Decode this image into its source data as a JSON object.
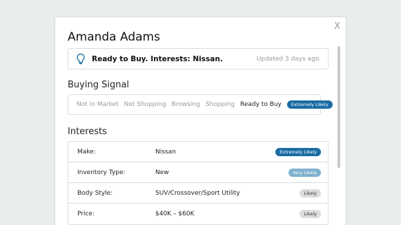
{
  "modal": {
    "close_label": "X",
    "name": "Amanda Adams",
    "summary": {
      "icon": "lightbulb-icon",
      "text": "Ready to Buy. Interests: Nissan.",
      "updated": "Updated 3 days ago."
    },
    "buying_signal": {
      "title": "Buying Signal",
      "steps": [
        "Not in Market",
        "Not Shopping",
        "Browsing",
        "Shopping",
        "Ready to Buy"
      ],
      "active_step": "Ready to Buy",
      "badge": "Extremely Likely"
    },
    "interests": {
      "title": "Interests",
      "rows": [
        {
          "label": "Make:",
          "value": "Nissan",
          "badge": "Extremely Likely"
        },
        {
          "label": "Inventory Type:",
          "value": "New",
          "badge": "Very Likely"
        },
        {
          "label": "Body Style:",
          "value": "SUV/Crossover/Sport Utility",
          "badge": "Likely"
        },
        {
          "label": "Price:",
          "value": "$40K – $60K",
          "badge": "Likely"
        }
      ]
    }
  },
  "colors": {
    "badge_extremely_likely": "#1a6ca3",
    "badge_very_likely": "#7fb1cf",
    "badge_likely": "#dcdcdc",
    "icon_accent": "#1a6ca3"
  }
}
